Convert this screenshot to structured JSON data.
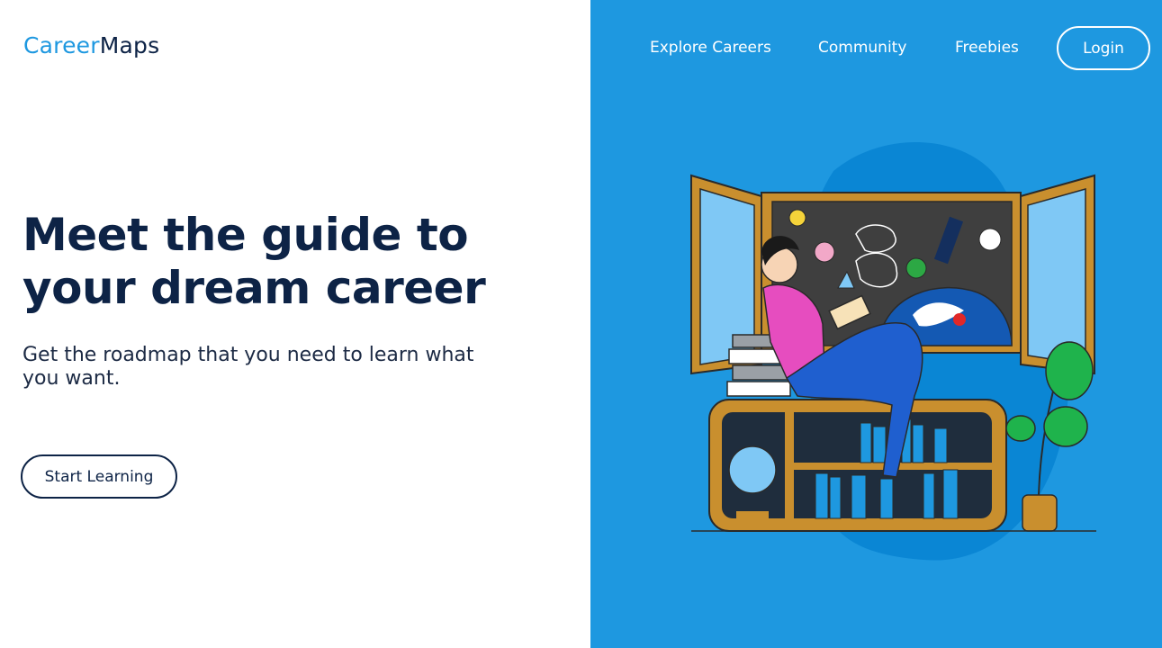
{
  "brand": {
    "name_part1": "Career",
    "name_part2": "Maps",
    "accent": "#1e98e0",
    "dark": "#0d2346"
  },
  "nav": {
    "links": [
      {
        "label": "Explore Careers"
      },
      {
        "label": "Community"
      },
      {
        "label": "Freebies"
      }
    ],
    "login_label": "Login"
  },
  "hero": {
    "headline_line1": "Meet the guide to",
    "headline_line2": "your dream career",
    "subheadline": "Get the roadmap that you need to learn what you want.",
    "cta_label": "Start Learning"
  },
  "illustration": {
    "subject": "person-reading-by-window-illustration",
    "panel_color": "#1e98e0"
  }
}
